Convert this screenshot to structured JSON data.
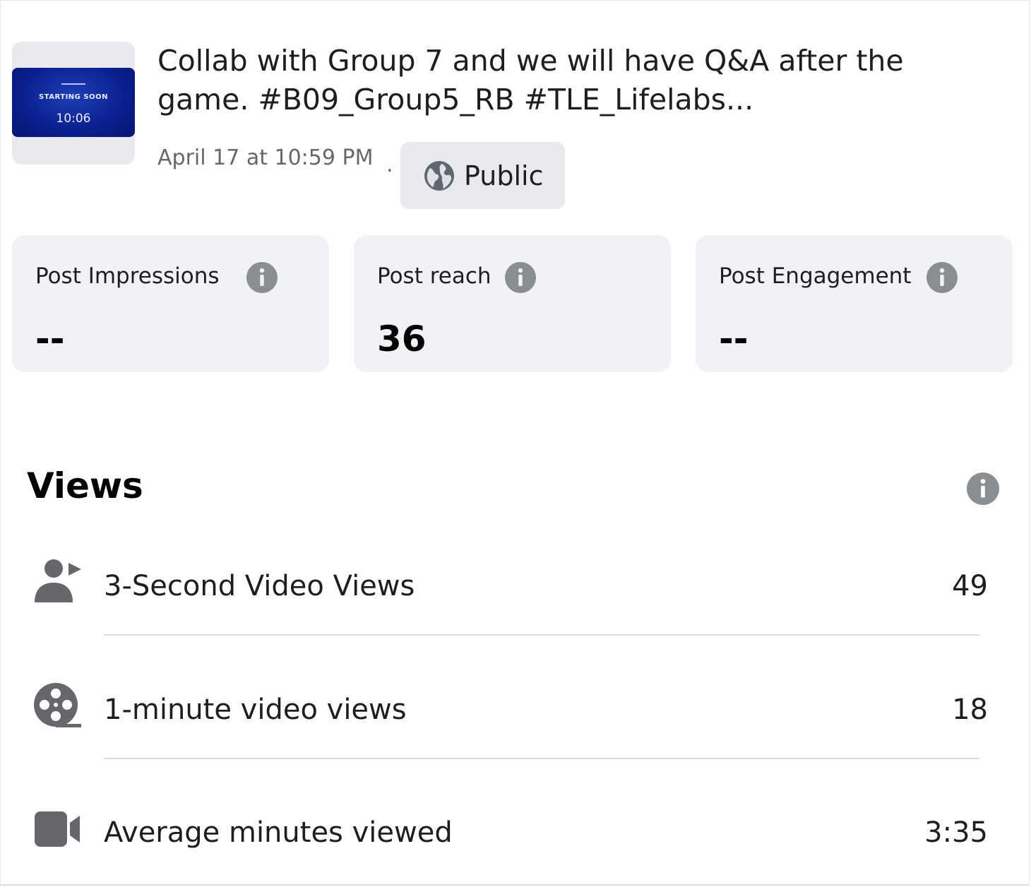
{
  "post": {
    "thumbnail": {
      "line1": "STARTING SOON",
      "line2": "10:06"
    },
    "title": "Collab with Group 7 and we will have Q&A after the game. #B09_Group5_RB #TLE_Lifelabs...",
    "timestamp": "April 17 at 10:59 PM",
    "separator": ".",
    "audience": "Public",
    "audience_icon": "globe-icon"
  },
  "stats": [
    {
      "label": "Post Impressions",
      "value": "--"
    },
    {
      "label": "Post reach",
      "value": "36"
    },
    {
      "label": "Post Engagement",
      "value": "--"
    }
  ],
  "views": {
    "title": "Views",
    "rows": [
      {
        "icon": "person-play-icon",
        "label": "3-Second Video Views",
        "value": "49"
      },
      {
        "icon": "film-reel-icon",
        "label": "1-minute video views",
        "value": "18"
      },
      {
        "icon": "video-camera-icon",
        "label": "Average minutes viewed",
        "value": "3:35"
      }
    ]
  },
  "colors": {
    "card_bg": "#f0f2f5",
    "icon_gray": "#65676b",
    "text_secondary": "#65676b"
  }
}
